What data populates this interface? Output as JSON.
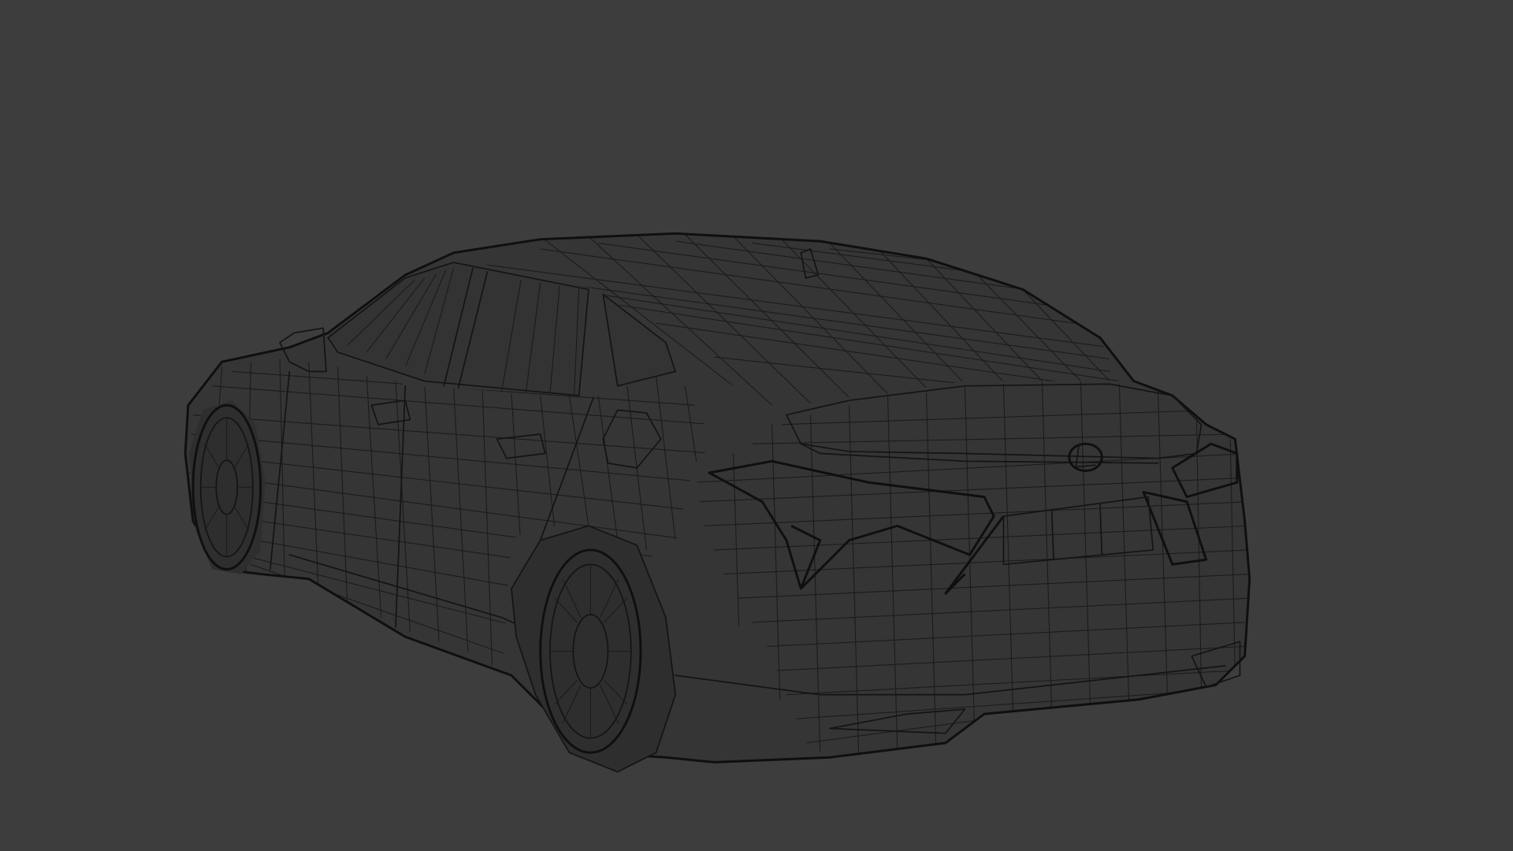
{
  "viewport": {
    "background_color": "#3d3d3d",
    "wire_color": "#141414",
    "shading": "wireframe"
  },
  "model": {
    "subject": "sedan-car",
    "emblem_icon": "lexus-logo-icon"
  }
}
